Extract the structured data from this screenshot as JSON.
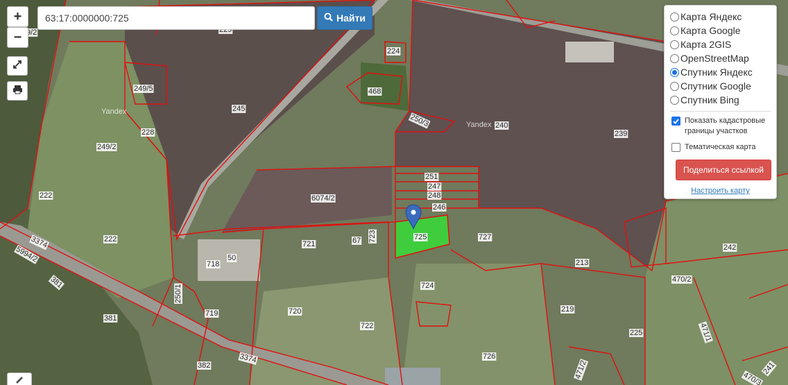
{
  "search": {
    "value": "63:17:0000000:725",
    "button_label": "Найти"
  },
  "zoom": {
    "in": "+",
    "out": "−"
  },
  "layers": [
    {
      "label": "Карта Яндекс",
      "selected": false
    },
    {
      "label": "Карта Google",
      "selected": false
    },
    {
      "label": "Карта 2GIS",
      "selected": false
    },
    {
      "label": "OpenStreetMap",
      "selected": false
    },
    {
      "label": "Спутник Яндекс",
      "selected": true
    },
    {
      "label": "Спутник Google",
      "selected": false
    },
    {
      "label": "Спутник Bing",
      "selected": false
    }
  ],
  "options": {
    "cadastral_label": "Показать кадастровые границы участков",
    "cadastral_checked": true,
    "thematic_label": "Тематическая карта",
    "thematic_checked": false
  },
  "share_button": "Поделиться ссылкой",
  "configure_link": "Настроить карту",
  "watermarks": [
    "Yandex",
    "Yandex"
  ],
  "parcels": {
    "p245": "245",
    "p224": "224",
    "p468": "468",
    "p249_5": "249/5",
    "p228": "228",
    "p249_2": "249/2",
    "p222a": "222",
    "p222b": "222",
    "p250_3": "250/3",
    "p240": "240",
    "p239": "239",
    "p251": "251",
    "p247": "247",
    "p248": "248",
    "p246": "246",
    "p6074_2": "6074/2",
    "p721": "721",
    "p67": "67",
    "p723": "723",
    "p725": "725",
    "p727": "727",
    "p213": "213",
    "p242": "242",
    "p718": "718",
    "p50": "50",
    "p3374a": "3374",
    "p5994_2": "5994/2",
    "p381a": "381",
    "p381b": "381",
    "p724": "724",
    "p470_2": "470/2",
    "p250_1": "250/1",
    "p720": "720",
    "p719": "719",
    "p219": "219",
    "p722": "722",
    "p471_1": "471/1",
    "p225": "225",
    "p382": "382",
    "p3374b": "3374",
    "p726": "726",
    "p471_2": "471/2",
    "p241": "241",
    "p470_3": "470/3",
    "p229": "229",
    "p9_2": "9/2"
  },
  "colors": {
    "selected_parcel": "#3cd23c",
    "parcel_border": "#e01010",
    "accent": "#337ab7",
    "share": "#d9534f"
  }
}
